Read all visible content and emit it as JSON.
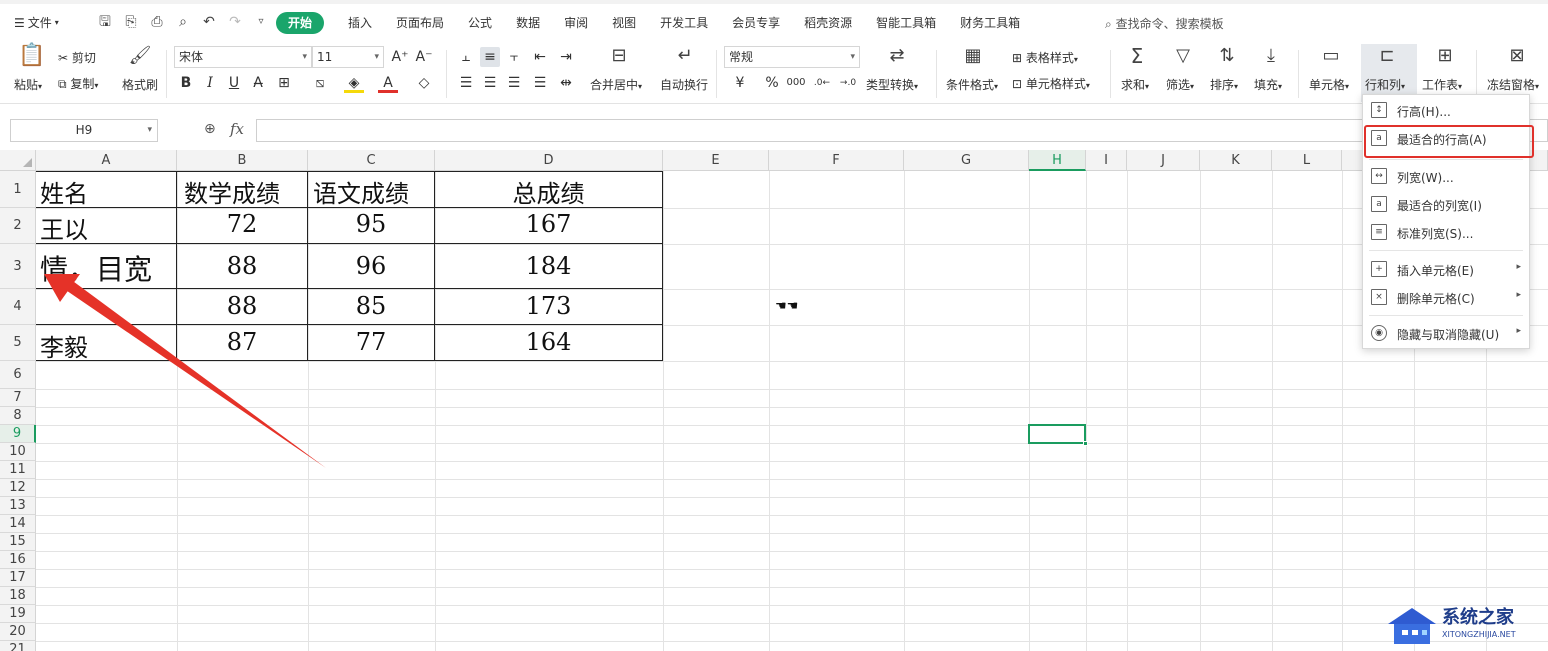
{
  "menubar": {
    "file_label": "文件",
    "tabs": [
      "开始",
      "插入",
      "页面布局",
      "公式",
      "数据",
      "审阅",
      "视图",
      "开发工具",
      "会员专享",
      "稻壳资源",
      "智能工具箱",
      "财务工具箱"
    ],
    "active_tab": "开始",
    "search_label": "查找命令、搜索模板",
    "accent_color": "#1aa56b"
  },
  "ribbon": {
    "paste": "粘贴",
    "cut": "剪切",
    "copy": "复制",
    "format_painter": "格式刷",
    "font_name": "宋体",
    "font_size": "11",
    "merge_center": "合并居中",
    "wrap_text": "自动换行",
    "number_format": "常规",
    "type_convert": "类型转换",
    "conditional_format": "条件格式",
    "table_style": "表格样式",
    "cell_style": "单元格样式",
    "sum": "求和",
    "filter": "筛选",
    "sort": "排序",
    "fill": "填充",
    "cell": "单元格",
    "row_col": "行和列",
    "worksheet": "工作表",
    "freeze": "冻结窗格"
  },
  "formula_bar": {
    "name_box": "H9",
    "fx": "fx",
    "formula": ""
  },
  "columns": [
    "A",
    "B",
    "C",
    "D",
    "E",
    "F",
    "G",
    "H",
    "I",
    "J",
    "K",
    "L"
  ],
  "selected_column": "H",
  "rows": [
    "1",
    "2",
    "3",
    "4",
    "5",
    "6",
    "7",
    "8",
    "9",
    "10",
    "11",
    "12",
    "13",
    "14",
    "15",
    "16",
    "17",
    "18",
    "19",
    "20",
    "21"
  ],
  "selected_row": "9",
  "table": {
    "headers": [
      "姓名",
      "数学成绩",
      "语文成绩",
      "总成绩"
    ],
    "rows": [
      [
        "王以",
        "72",
        "95",
        "167"
      ],
      [
        "情，目宽",
        "88",
        "96",
        "184"
      ],
      [
        "",
        "88",
        "85",
        "173"
      ],
      [
        "李毅",
        "87",
        "77",
        "164"
      ]
    ]
  },
  "dropdown": {
    "items": [
      {
        "label": "行高(H)...",
        "icon": "row-height-icon"
      },
      {
        "label": "最适合的行高(A)",
        "icon": "autofit-row-height-icon",
        "highlighted": true
      },
      {
        "label": "列宽(W)...",
        "icon": "column-width-icon"
      },
      {
        "label": "最适合的列宽(I)",
        "icon": "autofit-column-width-icon"
      },
      {
        "label": "标准列宽(S)...",
        "icon": "standard-width-icon"
      },
      {
        "label": "插入单元格(E)",
        "icon": "insert-cells-icon",
        "submenu": true
      },
      {
        "label": "删除单元格(C)",
        "icon": "delete-cells-icon",
        "submenu": true
      },
      {
        "label": "隐藏与取消隐藏(U)",
        "icon": "hide-unhide-icon",
        "submenu": true
      }
    ],
    "highlight_color": "#e0312b"
  },
  "watermark": {
    "text": "系统之家",
    "url": "XITONGZHIJIA.NET"
  }
}
